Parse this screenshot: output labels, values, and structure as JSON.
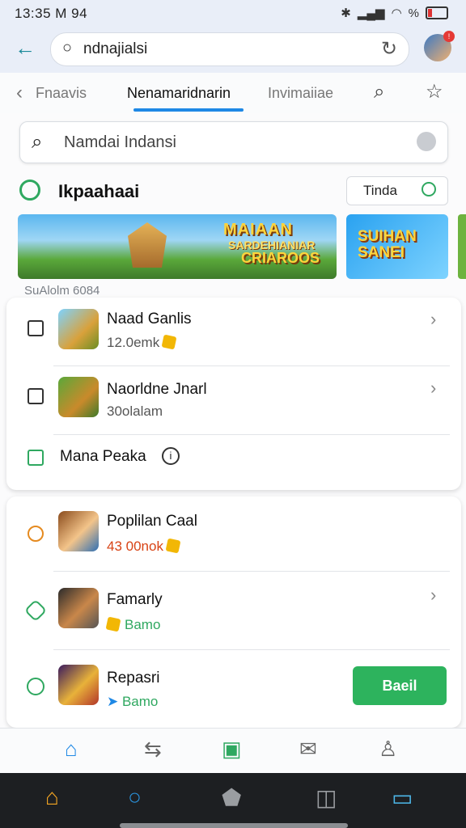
{
  "status": {
    "time": "13:35 M 94",
    "battery": "%"
  },
  "browser": {
    "url": "ndnajialsi"
  },
  "tabs": {
    "items": [
      "Fnaavis",
      "Nenamaridnarin",
      "Invimaiiae"
    ],
    "active": 1
  },
  "search": {
    "placeholder": "Namdai Indansi"
  },
  "section": {
    "title": "Ikpaahaai",
    "filter_label": "Tinda"
  },
  "banners": {
    "banner1": {
      "line1": "MAIAAN",
      "line2": "SARDEHIANIAR",
      "line3": "CRIAROOS"
    },
    "banner2": {
      "line1": "SUIHAN",
      "line2": "SANEI"
    }
  },
  "sub_label": "SuAlolm 6084",
  "list1": [
    {
      "title": "Naad Ganlis",
      "subtitle": "12.0emk"
    },
    {
      "title": "Naorldne Jnarl",
      "subtitle": "30olalam"
    },
    {
      "title": "Mana Peaka"
    }
  ],
  "list2": [
    {
      "title": "Poplilan Caal",
      "subtitle": "43 00nok"
    },
    {
      "title": "Famarly",
      "subtitle": "Bamo"
    },
    {
      "title": "Repasri",
      "subtitle": "Bamo",
      "button": "Baeil"
    }
  ],
  "icons": {
    "bottom_nav": [
      "home-icon",
      "transfer-icon",
      "calendar-icon",
      "mail-icon",
      "profile-icon"
    ],
    "system_nav": [
      "home-icon",
      "search-icon",
      "shape-icon",
      "square-icon",
      "app-icon"
    ]
  },
  "colors": {
    "accent": "#1e88e5",
    "green": "#2db35d",
    "orange": "#e58a1f",
    "home": "#f5a623"
  }
}
